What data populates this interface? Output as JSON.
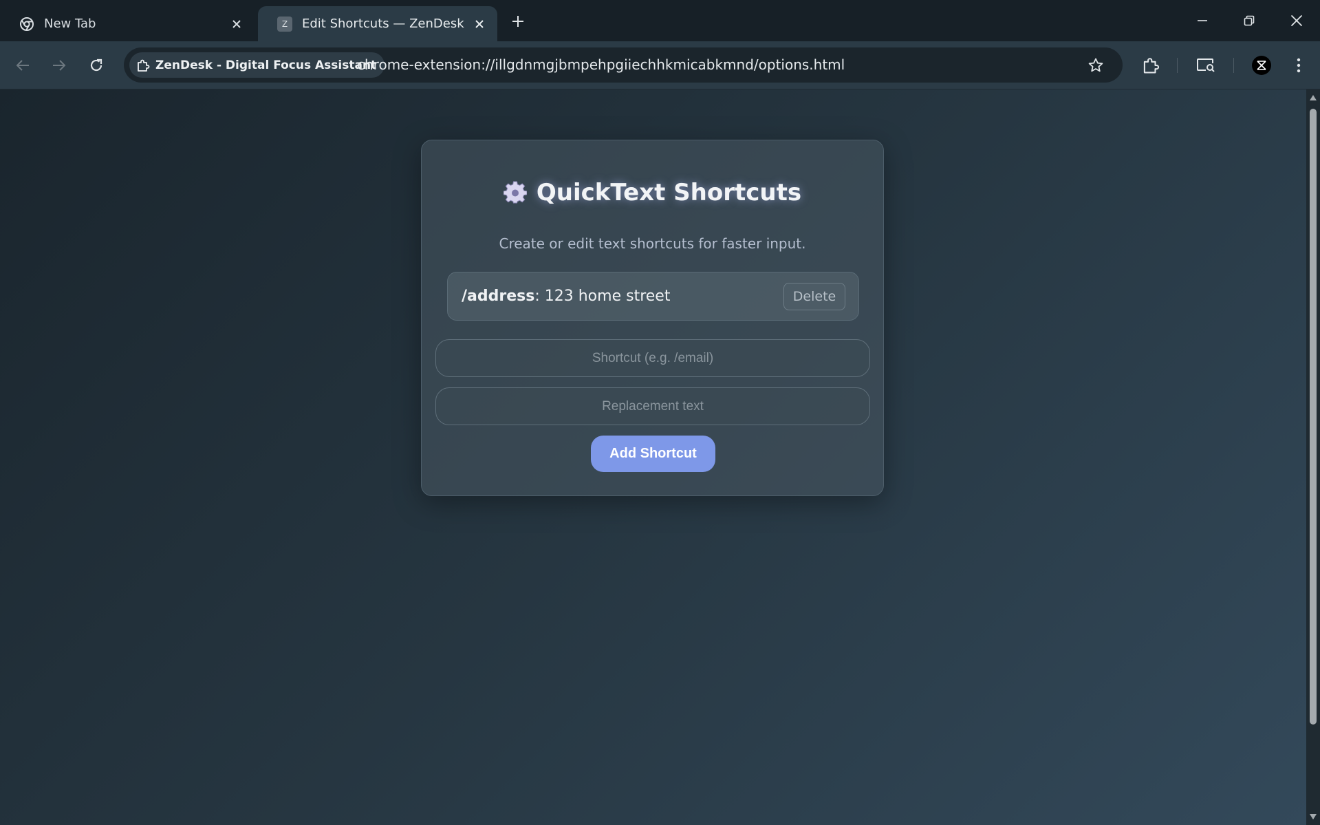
{
  "tabs": [
    {
      "title": "New Tab",
      "icon": "chrome-icon",
      "active": false
    },
    {
      "title": "Edit Shortcuts — ZenDesk",
      "icon": "z-favicon",
      "favicon_letter": "Z",
      "active": true
    }
  ],
  "omnibox": {
    "site_chip": "ZenDesk - Digital Focus Assistant",
    "url": "chrome-extension://illgdnmgjbmpehpgiiechhkmicabkmnd/options.html"
  },
  "card": {
    "title": "QuickText Shortcuts",
    "subtitle": "Create or edit text shortcuts for faster input.",
    "shortcuts": [
      {
        "key": "/address",
        "separator": ":",
        "value": " 123 home street",
        "delete_label": "Delete"
      }
    ],
    "shortcut_placeholder": "Shortcut (e.g. /email)",
    "replacement_placeholder": "Replacement text",
    "add_button": "Add Shortcut"
  },
  "colors": {
    "accent": "#7e98e8",
    "tab_active": "#2b3b46",
    "tabstrip": "#172027"
  }
}
